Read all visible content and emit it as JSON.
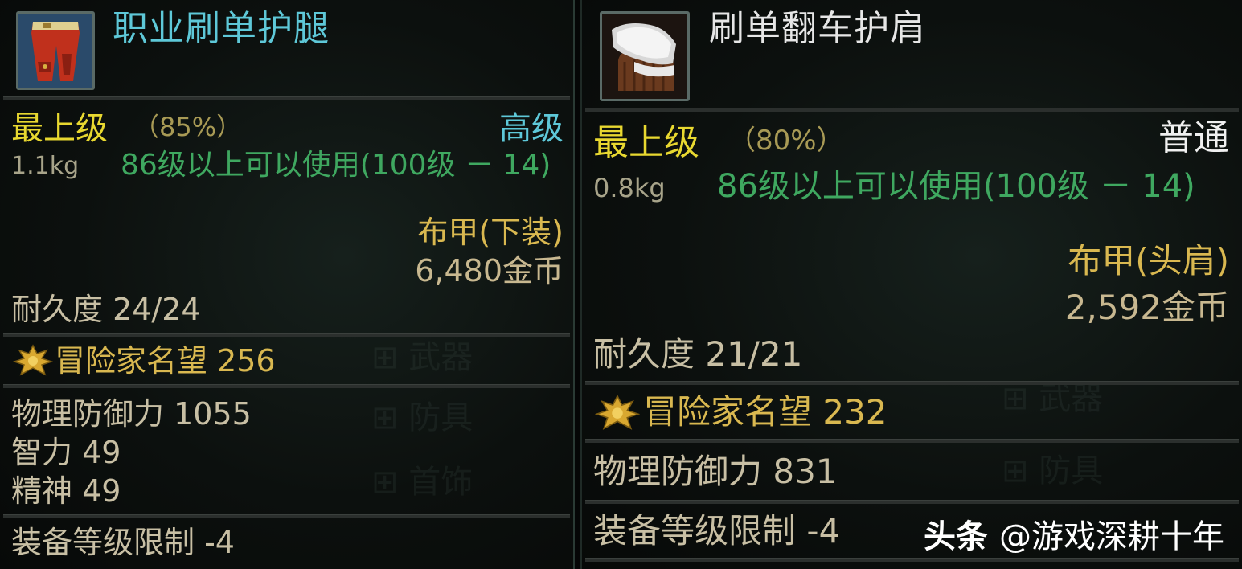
{
  "colors": {
    "name_left": "#5ec8d8",
    "name_right": "#e6e6e6",
    "grade_high": "#5ec8d8",
    "grade_normal": "#f0f0f0",
    "rarity": "#e8d830",
    "requirement": "#3fa860"
  },
  "left": {
    "item_name": "职业刷单护腿",
    "icon": "red-pants-icon",
    "rarity": "最上级",
    "rarity_percent": "（85%）",
    "grade": "高级",
    "weight": "1.1kg",
    "requirement": "86级以上可以使用(100级 － 14)",
    "type": "布甲(下装)",
    "price": "6,480金币",
    "durability": "耐久度 24/24",
    "fame": "冒险家名望 256",
    "stats": [
      "物理防御力 1055",
      "智力 49",
      "精神 49"
    ],
    "level_limit": "装备等级限制 -4"
  },
  "right": {
    "item_name": "刷单翻车护肩",
    "icon": "shoulder-pad-icon",
    "rarity": "最上级",
    "rarity_percent": "（80%）",
    "grade": "普通",
    "weight": "0.8kg",
    "requirement": "86级以上可以使用(100级 － 14)",
    "type": "布甲(头肩)",
    "price": "2,592金币",
    "durability": "耐久度 21/21",
    "fame": "冒险家名望 232",
    "stats": [
      "物理防御力 831"
    ],
    "level_limit": "装备等级限制 -4"
  },
  "watermark": {
    "brand": "头条",
    "handle": "@游戏深耕十年"
  }
}
